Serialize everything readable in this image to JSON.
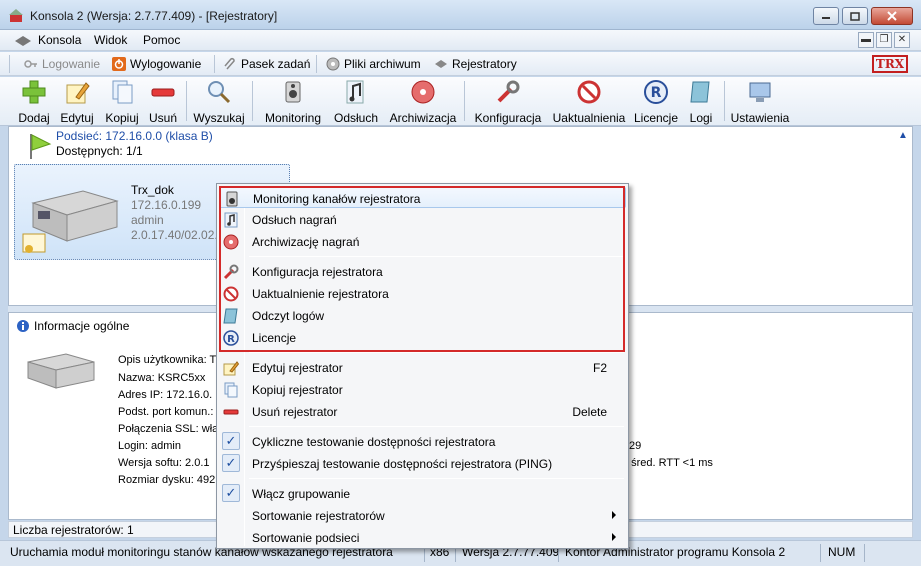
{
  "window": {
    "title": "Konsola 2 (Wersja:  2.7.77.409) - [Rejestratory]"
  },
  "menu": {
    "items": [
      "Konsola",
      "Widok",
      "Pomoc"
    ]
  },
  "quickbar": {
    "items": [
      "Logowanie",
      "Wylogowanie",
      "Pasek zadań",
      "Pliki archiwum",
      "Rejestratory"
    ],
    "logo": "TRX"
  },
  "toolbar": {
    "buttons": [
      "Dodaj",
      "Edytuj",
      "Kopiuj",
      "Usuń",
      "Wyszukaj",
      "Monitoring",
      "Odsłuch",
      "Archiwizacja",
      "Konfiguracja",
      "Uaktualnienia",
      "Licencje",
      "Logi",
      "Ustawienia"
    ]
  },
  "tree": {
    "subnet": "Podsieć: 172.16.0.0 (klasa B)",
    "available": "Dostępnych: 1/1"
  },
  "recorder": {
    "name": "Trx_dok",
    "ip": "172.16.0.199",
    "user": "admin",
    "version": "2.0.17.40/02.02.2015"
  },
  "info": {
    "title": "Informacje ogólne",
    "rows": [
      "Opis użytkownika: T",
      "Nazwa: KSRC5xx",
      "Adres IP: 172.16.0.",
      "Podst. port komun.:",
      "Połączenia SSL: włą",
      "Login: admin",
      "Wersja softu: 2.0.1",
      "Rozmiar dysku: 492,"
    ],
    "right_fragment_1": "29",
    "right_fragment_2": "/ śred. RTT <1 ms"
  },
  "count": "Liczba rejestratorów: 1",
  "status": {
    "hint": "Uruchamia moduł monitoringu stanów kanałów wskazanego rejestratora",
    "arch": "x86",
    "version": "Wersja 2.7.77.409",
    "user": "Kontor Administrator programu Konsola 2",
    "num": "NUM"
  },
  "context_menu": {
    "group1": [
      "Monitoring kanałów rejestratora",
      "Odsłuch nagrań",
      "Archiwizację nagrań"
    ],
    "group2": [
      "Konfiguracja rejestratora",
      "Uaktualnienie rejestratora",
      "Odczyt logów",
      "Licencje"
    ],
    "group3": [
      {
        "label": "Edytuj rejestrator",
        "shortcut": "F2"
      },
      {
        "label": "Kopiuj rejestrator",
        "shortcut": ""
      },
      {
        "label": "Usuń rejestrator",
        "shortcut": "Delete"
      }
    ],
    "group4": [
      "Cykliczne testowanie dostępności rejestratora",
      "Przyśpieszaj testowanie dostępności rejestratora (PING)"
    ],
    "group5": [
      "Włącz grupowanie",
      "Sortowanie rejestratorów",
      "Sortowanie podsieci"
    ]
  }
}
